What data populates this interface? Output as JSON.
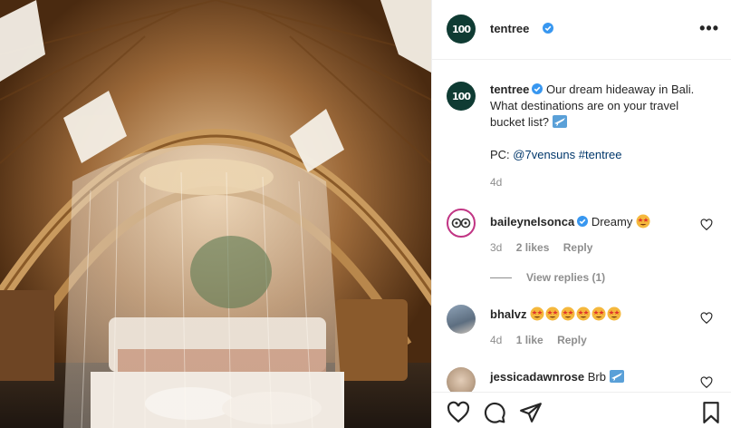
{
  "post": {
    "username": "tentree",
    "avatar_text": "100",
    "more_icon": "more-options-icon",
    "colors": {
      "brand_avatar": "#0f3b33",
      "link": "#00376b",
      "muted": "#8e8e8e",
      "verified": "#3897f0",
      "text": "#262626"
    }
  },
  "caption": {
    "username": "tentree",
    "text": "Our dream hideaway in Bali. What destinations are on your travel bucket list?",
    "emoji": "airplane-emoji",
    "pc_label": "PC:",
    "pc_user": "@7vensuns",
    "hashtag": "#tentree",
    "time": "4d"
  },
  "comments": [
    {
      "username": "baileynelsonca",
      "verified": true,
      "text": "Dreamy",
      "emoji_count": 1,
      "time": "3d",
      "likes": "2 likes",
      "reply": "Reply",
      "view_replies": "View replies (1)"
    },
    {
      "username": "bhalvz",
      "verified": false,
      "text": "",
      "emoji_count": 6,
      "time": "4d",
      "likes": "1 like",
      "reply": "Reply"
    },
    {
      "username": "jessicadawnrose",
      "verified": false,
      "text": "Brb",
      "emoji": "airplane-emoji"
    }
  ],
  "actions": [
    "like-icon",
    "comment-icon",
    "share-icon",
    "save-icon"
  ]
}
